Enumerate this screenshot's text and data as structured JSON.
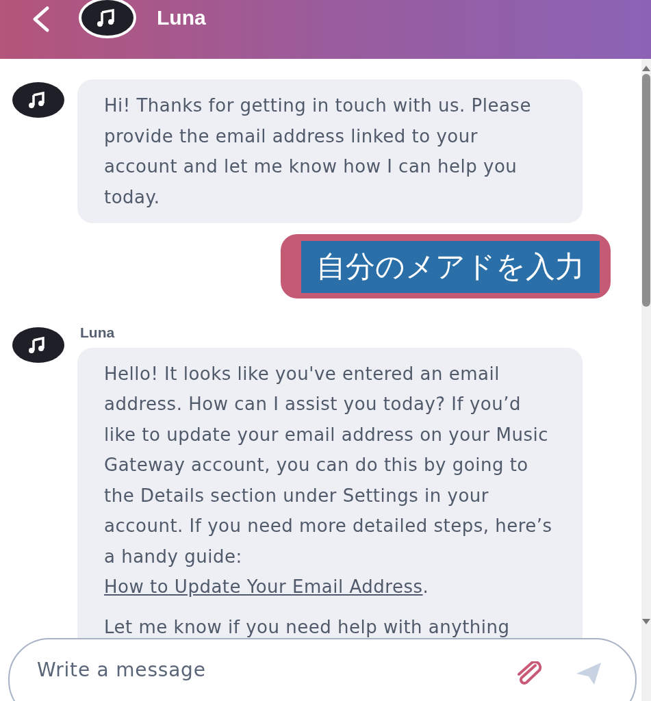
{
  "header": {
    "title": "Luna"
  },
  "messages": [
    {
      "kind": "bot",
      "paragraphs": [
        {
          "parts": [
            {
              "kind": "text",
              "text": "Hi! Thanks for getting in touch with us. Please provide the email address linked to your account and let me know how I can help you today."
            }
          ]
        }
      ]
    },
    {
      "kind": "user",
      "text": "自分のメアドを入力"
    },
    {
      "kind": "bot",
      "sender": "Luna",
      "paragraphs": [
        {
          "parts": [
            {
              "kind": "text",
              "text": "Hello! It looks like you've entered an email address. How can I assist you today? If you’d like to update your email address on your Music Gateway account, you can do this by going to the Details section under Settings in your account. If you need more detailed steps, here’s a handy guide: "
            },
            {
              "kind": "link",
              "text": "How to Update Your Email Address"
            },
            {
              "kind": "text",
              "text": "."
            }
          ]
        },
        {
          "parts": [
            {
              "kind": "text",
              "text": "Let me know if you need help with anything"
            }
          ]
        }
      ]
    }
  ],
  "composer": {
    "placeholder": "Write a message"
  }
}
